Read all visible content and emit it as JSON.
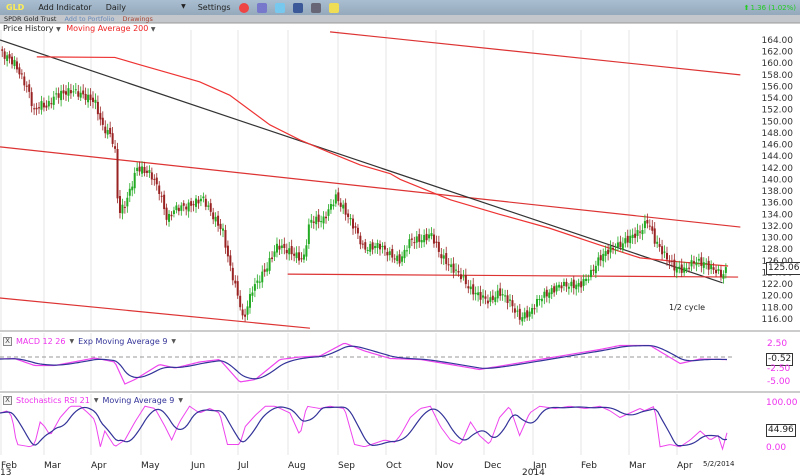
{
  "toolbar": {
    "symbol": "GLD",
    "add_indicator": "Add Indicator",
    "period": "Daily",
    "period_caret": "▼",
    "settings": "Settings",
    "change": "1.36 (1.02%)",
    "change_color": "#22cc22",
    "icons": [
      "alarm-clock-icon",
      "notebook-icon",
      "twitter-icon",
      "facebook-icon",
      "print-icon",
      "sticky-note-icon"
    ]
  },
  "subbar": {
    "name": "SPDR Gold Trust",
    "add_portfolio": "Add to Portfolio",
    "drawings": "Drawings"
  },
  "main_panel": {
    "price_history": "Price History",
    "ma_label": "Moving Average 200",
    "caret": "▼",
    "annotation": "1/2 cycle",
    "last_price": "125.06"
  },
  "macd_panel": {
    "close": "X",
    "label": "MACD 12 26",
    "signal_label": "Exp Moving Average 9",
    "caret": "▼",
    "last_value": "-0.52",
    "axis": [
      "2.50",
      "-2.50",
      "-5.00"
    ]
  },
  "stoch_panel": {
    "close": "X",
    "label": "Stochastics RSI 21",
    "signal_label": "Moving Average 9",
    "caret": "▼",
    "last_value": "44.96",
    "axis": [
      "100.00",
      "0.00"
    ]
  },
  "x_axis": {
    "months": [
      "Feb",
      "Mar",
      "Apr",
      "May",
      "Jun",
      "Jul",
      "Aug",
      "Sep",
      "Oct",
      "Nov",
      "Dec",
      "Jan",
      "Feb",
      "Mar",
      "Apr"
    ],
    "years": [
      "13",
      "2014"
    ],
    "end_date": "5/2/2014"
  },
  "chart_data": {
    "type": "line",
    "title": "GLD Daily",
    "y_ticks": [
      "164.00",
      "162.00",
      "160.00",
      "158.00",
      "156.00",
      "154.00",
      "152.00",
      "150.00",
      "148.00",
      "146.00",
      "144.00",
      "142.00",
      "140.00",
      "138.00",
      "136.00",
      "134.00",
      "132.00",
      "130.00",
      "128.00",
      "126.00",
      "124.00",
      "122.00",
      "120.00",
      "118.00",
      "116.00"
    ],
    "ylim": [
      115,
      165.5
    ],
    "x_unit": "weeks since Feb 2013",
    "price_keypoints": [
      [
        0,
        162
      ],
      [
        1.3,
        160
      ],
      [
        2.5,
        155.5
      ],
      [
        3.1,
        151.5
      ],
      [
        3.6,
        153
      ],
      [
        4.2,
        152.5
      ],
      [
        5,
        154.5
      ],
      [
        6.5,
        155.3
      ],
      [
        8.5,
        153.5
      ],
      [
        9.2,
        149
      ],
      [
        10,
        147.5
      ],
      [
        10.4,
        144
      ],
      [
        10.6,
        134
      ],
      [
        11.3,
        136
      ],
      [
        12.3,
        142
      ],
      [
        13.5,
        141
      ],
      [
        14.3,
        138
      ],
      [
        15,
        133
      ],
      [
        15.7,
        135
      ],
      [
        17,
        135.5
      ],
      [
        18.2,
        136.8
      ],
      [
        19,
        134
      ],
      [
        20,
        131
      ],
      [
        20.5,
        126
      ],
      [
        21.6,
        118
      ],
      [
        21.8,
        115.5
      ],
      [
        22.6,
        121
      ],
      [
        23.8,
        124.4
      ],
      [
        24.9,
        128.7
      ],
      [
        26.5,
        127
      ],
      [
        27.2,
        126
      ],
      [
        27.8,
        133
      ],
      [
        29,
        133
      ],
      [
        30.1,
        137
      ],
      [
        30.8,
        135
      ],
      [
        31.4,
        133
      ],
      [
        32,
        131
      ],
      [
        32.6,
        128
      ],
      [
        34,
        128.7
      ],
      [
        35,
        127
      ],
      [
        35.9,
        126
      ],
      [
        36.8,
        129.6
      ],
      [
        37.7,
        129.6
      ],
      [
        38.7,
        130.5
      ],
      [
        39.5,
        127
      ],
      [
        40.4,
        125
      ],
      [
        41.3,
        123.5
      ],
      [
        42.2,
        121
      ],
      [
        43,
        120
      ],
      [
        43.9,
        119
      ],
      [
        44.8,
        120.6
      ],
      [
        45.7,
        119
      ],
      [
        46.6,
        116.2
      ],
      [
        47.5,
        117
      ],
      [
        48.4,
        119.6
      ],
      [
        49.3,
        120.6
      ],
      [
        50.2,
        121.8
      ],
      [
        51.1,
        121.8
      ],
      [
        52,
        121.8
      ],
      [
        52.9,
        123.5
      ],
      [
        53.8,
        126.5
      ],
      [
        54.7,
        128
      ],
      [
        55.6,
        128.7
      ],
      [
        56.5,
        130
      ],
      [
        57.4,
        131
      ],
      [
        58.1,
        133
      ],
      [
        58.7,
        129.6
      ],
      [
        59.6,
        127
      ],
      [
        60.5,
        124.8
      ],
      [
        61.4,
        124.4
      ],
      [
        62.3,
        126
      ],
      [
        63.2,
        125.5
      ],
      [
        64.1,
        124.4
      ],
      [
        64.8,
        123.5
      ],
      [
        65.3,
        125.06
      ]
    ],
    "ma200_keypoints": [
      [
        3.3,
        161.1
      ],
      [
        10.3,
        161
      ],
      [
        12.6,
        159.7
      ],
      [
        17.9,
        156.8
      ],
      [
        20.6,
        154.5
      ],
      [
        24.2,
        149.4
      ],
      [
        26.9,
        146.8
      ],
      [
        29.6,
        144.6
      ],
      [
        32.3,
        142.5
      ],
      [
        35,
        141
      ],
      [
        35.9,
        140
      ],
      [
        40.4,
        136.5
      ],
      [
        44.8,
        134
      ],
      [
        49.3,
        131.6
      ],
      [
        53.8,
        128.7
      ],
      [
        57.4,
        126.5
      ],
      [
        61,
        125.8
      ],
      [
        65.3,
        125.1
      ]
    ],
    "trendlines": [
      {
        "name": "upper-channel",
        "color": "#dd3333",
        "from": [
          29.6,
          165.4
        ],
        "to": [
          66.4,
          158
        ]
      },
      {
        "name": "middle-channel",
        "color": "#dd3333",
        "from": [
          0,
          145.6
        ],
        "to": [
          66.4,
          131.8
        ]
      },
      {
        "name": "lower-channel",
        "color": "#dd3333",
        "from": [
          0,
          119.6
        ],
        "to": [
          27.8,
          114.4
        ]
      },
      {
        "name": "black-downtrend",
        "color": "#333333",
        "from": [
          0,
          164
        ],
        "to": [
          64.8,
          122.2
        ]
      },
      {
        "name": "support-line",
        "color": "#dd3333",
        "from": [
          25.8,
          123.7
        ],
        "to": [
          66.2,
          123.2
        ]
      }
    ],
    "macd_keypoints": [
      [
        0,
        -0.4
      ],
      [
        1.3,
        -0.3
      ],
      [
        3.1,
        -1.7
      ],
      [
        4.9,
        -1.7
      ],
      [
        8.5,
        -0.2
      ],
      [
        10.3,
        -1
      ],
      [
        11.2,
        -5.4
      ],
      [
        12.1,
        -4.5
      ],
      [
        14.3,
        -1.5
      ],
      [
        15.7,
        -2.2
      ],
      [
        17.9,
        -1
      ],
      [
        19.7,
        -0.5
      ],
      [
        21.5,
        -5
      ],
      [
        22.9,
        -4.5
      ],
      [
        25.1,
        -0.5
      ],
      [
        26.9,
        0
      ],
      [
        28.7,
        0.2
      ],
      [
        30.9,
        2.8
      ],
      [
        32.7,
        1.2
      ],
      [
        35,
        -0.3
      ],
      [
        37.7,
        -0.5
      ],
      [
        40.4,
        -1.5
      ],
      [
        43,
        -2.5
      ],
      [
        45.7,
        -1.5
      ],
      [
        48.4,
        -0.5
      ],
      [
        51.1,
        0.5
      ],
      [
        53.8,
        1.5
      ],
      [
        55.6,
        2.3
      ],
      [
        58.3,
        2.3
      ],
      [
        61,
        -1.3
      ],
      [
        62.8,
        -0.4
      ],
      [
        65.3,
        -0.52
      ]
    ],
    "macd_ylim": [
      -6,
      4
    ],
    "stoch_keypoints": [
      [
        0,
        80
      ],
      [
        0.7,
        85
      ],
      [
        1.1,
        70
      ],
      [
        1.5,
        10
      ],
      [
        2.7,
        5
      ],
      [
        3.1,
        10
      ],
      [
        3.6,
        60
      ],
      [
        4,
        50
      ],
      [
        4.5,
        30
      ],
      [
        5.4,
        70
      ],
      [
        6.3,
        95
      ],
      [
        7.2,
        95
      ],
      [
        7.9,
        80
      ],
      [
        8.5,
        65
      ],
      [
        9,
        5
      ],
      [
        9.4,
        40
      ],
      [
        10.3,
        5
      ],
      [
        11.2,
        20
      ],
      [
        12.1,
        60
      ],
      [
        13,
        95
      ],
      [
        13.9,
        90
      ],
      [
        14.8,
        50
      ],
      [
        15.4,
        20
      ],
      [
        16.1,
        60
      ],
      [
        17,
        95
      ],
      [
        17.9,
        80
      ],
      [
        18.8,
        90
      ],
      [
        19.7,
        80
      ],
      [
        20.4,
        10
      ],
      [
        21.5,
        10
      ],
      [
        22,
        50
      ],
      [
        22.9,
        75
      ],
      [
        23.8,
        95
      ],
      [
        24.7,
        95
      ],
      [
        26,
        80
      ],
      [
        26.9,
        30
      ],
      [
        27.5,
        95
      ],
      [
        28.7,
        90
      ],
      [
        29.6,
        95
      ],
      [
        30.9,
        90
      ],
      [
        31.8,
        10
      ],
      [
        32.7,
        5
      ],
      [
        34.5,
        20
      ],
      [
        35.4,
        15
      ],
      [
        35.9,
        30
      ],
      [
        36.8,
        70
      ],
      [
        37.7,
        90
      ],
      [
        38.6,
        95
      ],
      [
        39.5,
        50
      ],
      [
        40.4,
        20
      ],
      [
        41.3,
        10
      ],
      [
        42.2,
        60
      ],
      [
        43,
        30
      ],
      [
        43.9,
        10
      ],
      [
        44.8,
        70
      ],
      [
        45.7,
        95
      ],
      [
        46.6,
        30
      ],
      [
        47.5,
        80
      ],
      [
        48.4,
        95
      ],
      [
        49.8,
        90
      ],
      [
        51.1,
        95
      ],
      [
        52.5,
        90
      ],
      [
        53.8,
        95
      ],
      [
        54.7,
        85
      ],
      [
        55.6,
        70
      ],
      [
        56.5,
        80
      ],
      [
        57.4,
        90
      ],
      [
        57.8,
        85
      ],
      [
        58.7,
        95
      ],
      [
        59.2,
        5
      ],
      [
        60.1,
        10
      ],
      [
        61,
        5
      ],
      [
        61.9,
        20
      ],
      [
        62.8,
        40
      ],
      [
        63.7,
        20
      ],
      [
        64.4,
        30
      ],
      [
        64.8,
        0
      ],
      [
        65.3,
        44.96
      ]
    ],
    "stoch_ylim": [
      0,
      100
    ],
    "colors": {
      "up": "#22aa22",
      "down": "#992222",
      "ma": "#ee3333",
      "macd": "#ee44ee",
      "signal": "#333399"
    }
  }
}
